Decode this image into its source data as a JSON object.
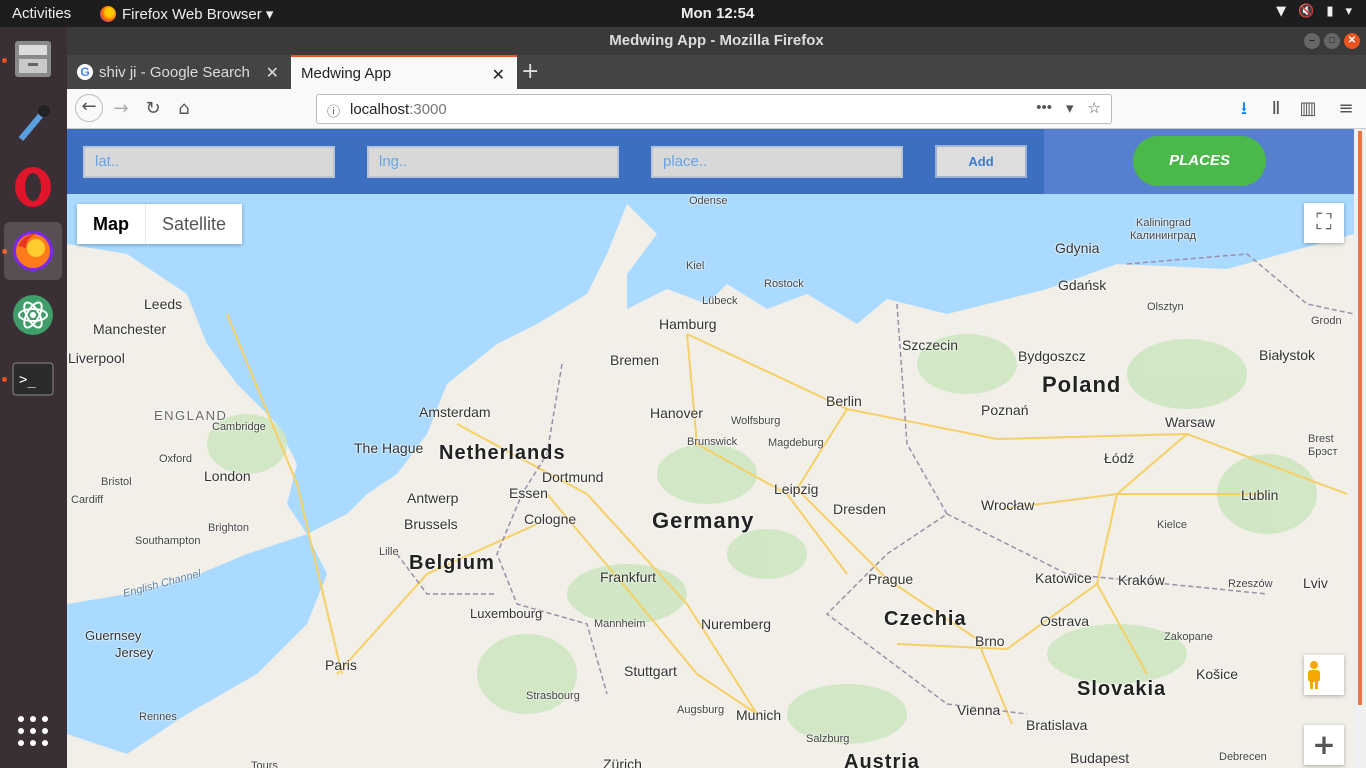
{
  "system": {
    "activities": "Activities",
    "app_menu": "Firefox Web Browser ▾",
    "clock": "Mon 12:54"
  },
  "window": {
    "title": "Medwing App - Mozilla Firefox"
  },
  "tabs": [
    {
      "label": "shiv ji - Google Search"
    },
    {
      "label": "Medwing App"
    }
  ],
  "url": {
    "host": "localhost",
    "port": ":3000"
  },
  "app": {
    "lat_placeholder": "lat..",
    "lng_placeholder": "lng..",
    "place_placeholder": "place..",
    "add_label": "Add",
    "places_label": "PLACES"
  },
  "map": {
    "type_map": "Map",
    "type_satellite": "Satellite",
    "countries": [
      "Netherlands",
      "Belgium",
      "Germany",
      "Poland",
      "Czechia",
      "Slovakia",
      "Austria"
    ],
    "regions": [
      "ENGLAND"
    ],
    "water": [
      "English Channel"
    ],
    "cities": [
      "Leeds",
      "Manchester",
      "Liverpool",
      "Cambridge",
      "Oxford",
      "London",
      "Bristol",
      "Cardiff",
      "Brighton",
      "Southampton",
      "Guernsey",
      "Jersey",
      "Rennes",
      "Paris",
      "Lille",
      "Amsterdam",
      "The Hague",
      "Antwerp",
      "Brussels",
      "Luxembourg",
      "Dortmund",
      "Essen",
      "Cologne",
      "Frankfurt",
      "Mannheim",
      "Stuttgart",
      "Strasbourg",
      "Augsburg",
      "Munich",
      "Nuremberg",
      "Hamburg",
      "Bremen",
      "Hanover",
      "Kiel",
      "Lübeck",
      "Rostock",
      "Odense",
      "Wolfsburg",
      "Brunswick",
      "Magdeburg",
      "Berlin",
      "Leipzig",
      "Dresden",
      "Prague",
      "Brno",
      "Szczecin",
      "Gdynia",
      "Gdańsk",
      "Bydgoszcz",
      "Poznań",
      "Warsaw",
      "Łódź",
      "Wrocław",
      "Katowice",
      "Kraków",
      "Lublin",
      "Kielce",
      "Ostrava",
      "Olsztyn",
      "Białystok",
      "Rzeszów",
      "Lviv",
      "Košice",
      "Vienna",
      "Bratislava",
      "Budapest",
      "Salzburg",
      "Zürich",
      "Tours",
      "Debrecen",
      "Zakopane",
      "Kaliningrad",
      "Калининград",
      "Brest",
      "Брэст",
      "Grodn"
    ]
  }
}
